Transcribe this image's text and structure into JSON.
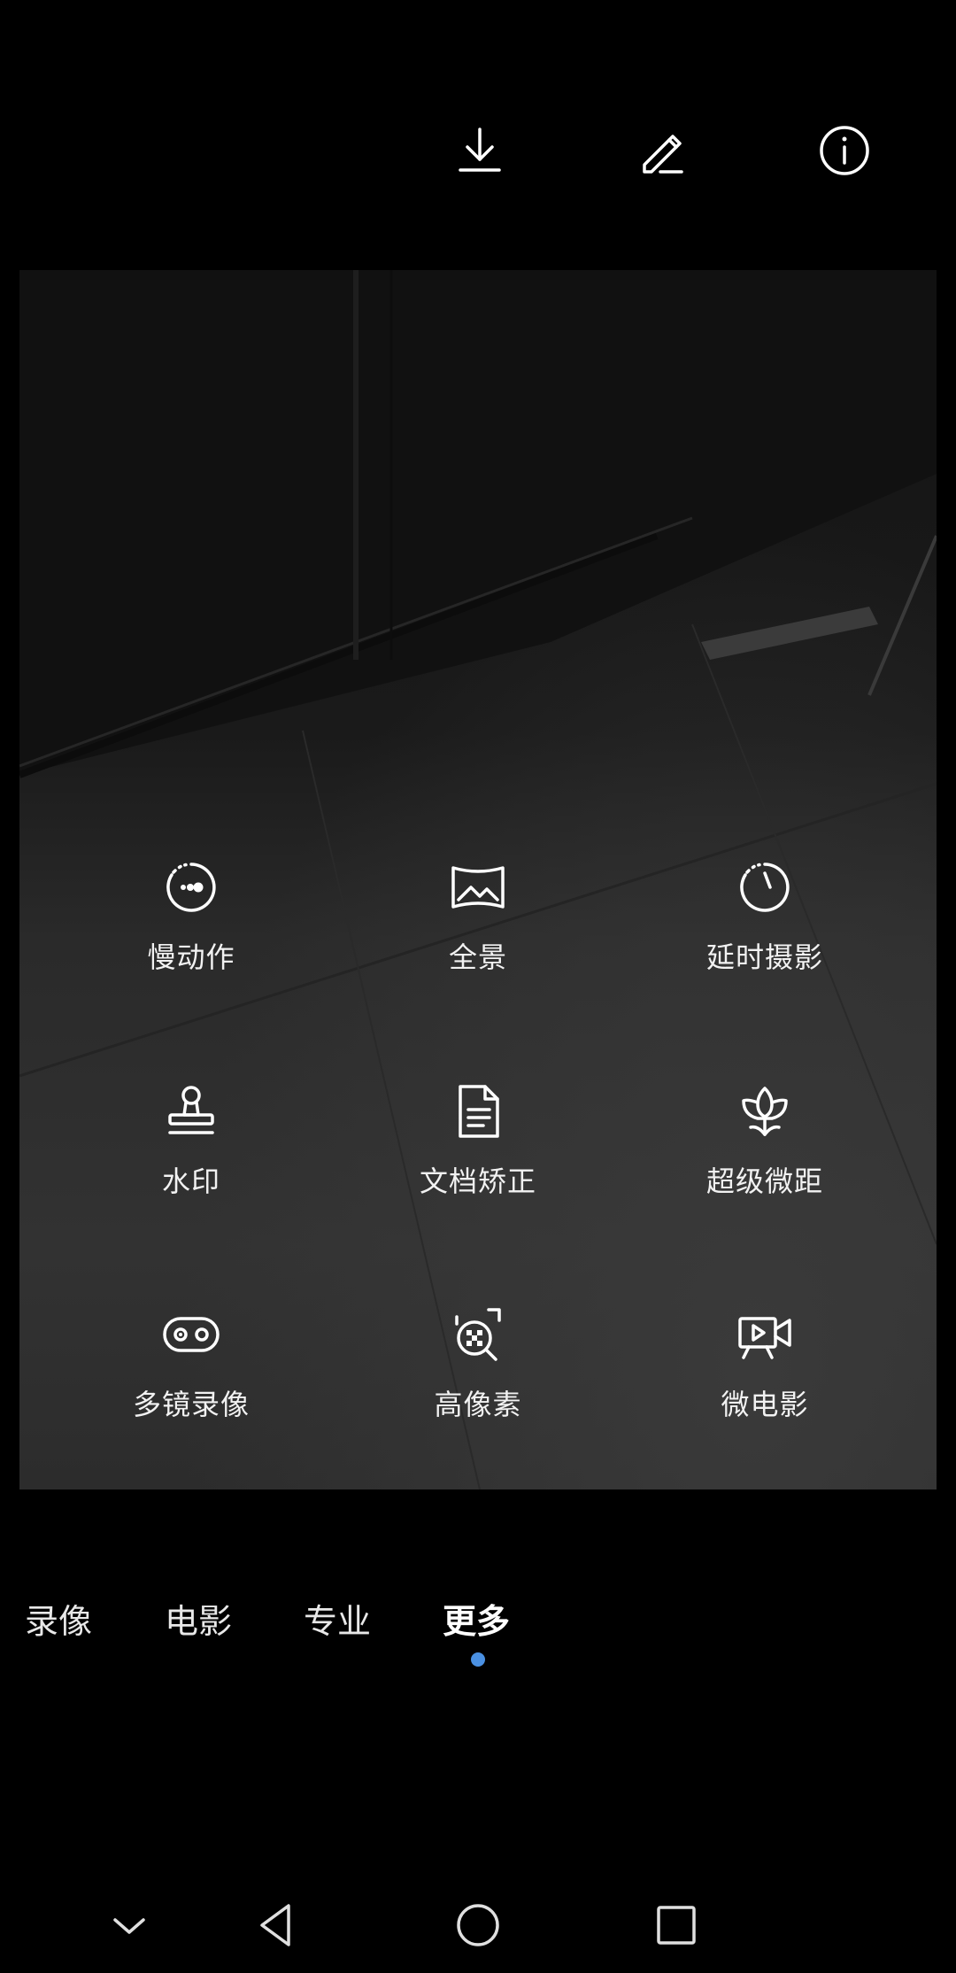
{
  "top_bar": {
    "icons": [
      "download-icon",
      "edit-icon",
      "info-icon"
    ]
  },
  "modes": [
    {
      "label": "慢动作",
      "icon": "slow-motion-icon"
    },
    {
      "label": "全景",
      "icon": "panorama-icon"
    },
    {
      "label": "延时摄影",
      "icon": "timelapse-icon"
    },
    {
      "label": "水印",
      "icon": "stamp-icon"
    },
    {
      "label": "文档矫正",
      "icon": "document-icon"
    },
    {
      "label": "超级微距",
      "icon": "macro-flower-icon"
    },
    {
      "label": "多镜录像",
      "icon": "multi-lens-icon"
    },
    {
      "label": "高像素",
      "icon": "high-res-icon"
    },
    {
      "label": "微电影",
      "icon": "video-play-icon"
    }
  ],
  "tabs": [
    {
      "label": "录像",
      "active": false
    },
    {
      "label": "电影",
      "active": false
    },
    {
      "label": "专业",
      "active": false
    },
    {
      "label": "更多",
      "active": true
    }
  ],
  "colors": {
    "accent_dot": "#4a90e2",
    "background": "#000000"
  },
  "nav": [
    "collapse-icon",
    "back-icon",
    "home-icon",
    "recents-icon"
  ]
}
